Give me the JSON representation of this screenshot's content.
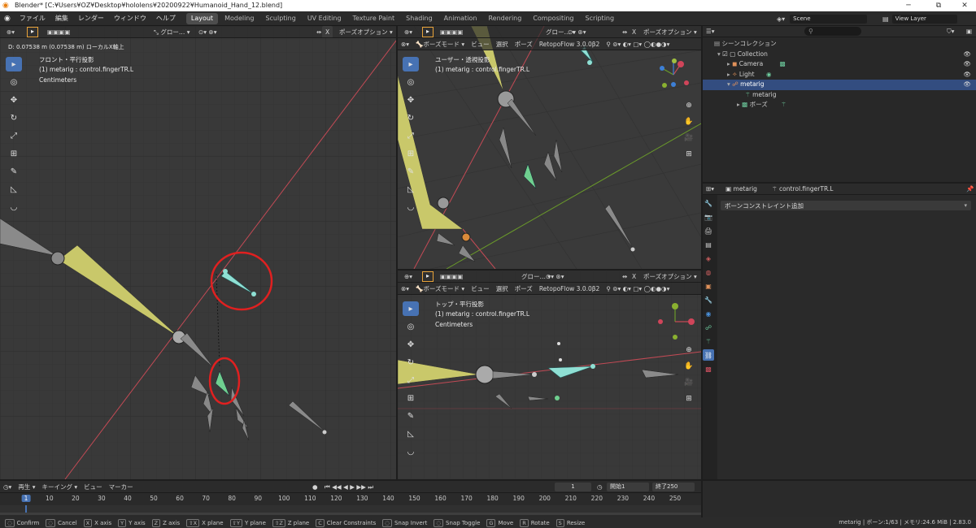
{
  "titlebar": {
    "title": "Blender* [C:¥Users¥OZ¥Desktop¥hololens¥20200922¥Humanoid_Hand_12.blend]",
    "minimize": "─",
    "maximize": "⧉",
    "close": "✕"
  },
  "menubar": {
    "menus": [
      "ファイル",
      "編集",
      "レンダー",
      "ウィンドウ",
      "ヘルプ"
    ],
    "workspaces": [
      "Layout",
      "Modeling",
      "Sculpting",
      "UV Editing",
      "Texture Paint",
      "Shading",
      "Animation",
      "Rendering",
      "Compositing",
      "Scripting"
    ],
    "active_workspace": "Layout",
    "scene": "Scene",
    "view_layer": "View Layer"
  },
  "viewport_main": {
    "header": {
      "orientation": "グロー…",
      "pose_options": "ポーズオプション",
      "x_label": "X"
    },
    "measure_text": "D: 0.07538 m (0.07538 m) ローカルX軸上",
    "view_name": "フロント・平行投影",
    "object_info": "(1) metarig : control.fingerTR.L",
    "units": "Centimeters"
  },
  "viewport_user": {
    "header": {
      "mode": "ボーズモード",
      "view": "ビュー",
      "select": "選択",
      "pose": "ポーズ",
      "addon": "RetopoFlow 3.0.0β2",
      "orientation": "グロー…",
      "pose_options": "ポーズオプション",
      "x_label": "X"
    },
    "view_name": "ユーザー・透視投影",
    "object_info": "(1) metarig : control.fingerTR.L"
  },
  "viewport_top": {
    "header": {
      "mode": "ボーズモード",
      "view": "ビュー",
      "select": "選択",
      "pose": "ポーズ",
      "addon": "RetopoFlow 3.0.0β2",
      "orientation": "グロー…",
      "pose_options": "ポーズオプション",
      "x_label": "X"
    },
    "view_name": "トップ・平行投影",
    "object_info": "(1) metarig : control.fingerTR.L",
    "units": "Centimeters"
  },
  "outliner": {
    "search_placeholder": "",
    "items": [
      {
        "label": "シーンコレクション",
        "indent": 0
      },
      {
        "label": "Collection",
        "indent": 1
      },
      {
        "label": "Camera",
        "indent": 2
      },
      {
        "label": "Light",
        "indent": 2
      },
      {
        "label": "metarig",
        "indent": 2
      },
      {
        "label": "metarig",
        "indent": 3
      },
      {
        "label": "ボーズ",
        "indent": 3
      }
    ],
    "selected_index": 4
  },
  "properties": {
    "object_name": "metarig",
    "bone_name": "control.fingerTR.L",
    "add_constraint": "ボーンコンストレイント追加"
  },
  "timeline": {
    "playback": "再生",
    "keying": "キーイング",
    "view": "ビュー",
    "marker": "マーカー",
    "current_frame": "1",
    "start_label": "開始",
    "start": "1",
    "end_label": "終了",
    "end": "250",
    "ticks": [
      "1",
      "10",
      "20",
      "30",
      "40",
      "50",
      "60",
      "70",
      "80",
      "90",
      "100",
      "110",
      "120",
      "130",
      "140",
      "150",
      "160",
      "170",
      "180",
      "190",
      "200",
      "210",
      "220",
      "230",
      "240",
      "250"
    ]
  },
  "statusbar": {
    "items": [
      {
        "key": "",
        "label": "Confirm"
      },
      {
        "key": "",
        "label": "Cancel"
      },
      {
        "key": "X",
        "label": "X axis"
      },
      {
        "key": "Y",
        "label": "Y axis"
      },
      {
        "key": "Z",
        "label": "Z axis"
      },
      {
        "key": "⇧X",
        "label": "X plane"
      },
      {
        "key": "⇧Y",
        "label": "Y plane"
      },
      {
        "key": "⇧Z",
        "label": "Z plane"
      },
      {
        "key": "C",
        "label": "Clear Constraints"
      },
      {
        "key": "",
        "label": "Snap Invert"
      },
      {
        "key": "",
        "label": "Snap Toggle"
      },
      {
        "key": "G",
        "label": "Move"
      },
      {
        "key": "R",
        "label": "Rotate"
      },
      {
        "key": "S",
        "label": "Resize"
      }
    ],
    "right_info": "metarig | ボーン:1/63 | メモリ:24.6 MiB | 2.83.0"
  },
  "colors": {
    "selection_blue": "#4772b3",
    "bone_yellow": "#c9c86a",
    "bone_active": "#8fe0d4",
    "annotation_red": "#e02020",
    "axis_red": "#c44a55",
    "axis_green": "#6a9a2a"
  }
}
